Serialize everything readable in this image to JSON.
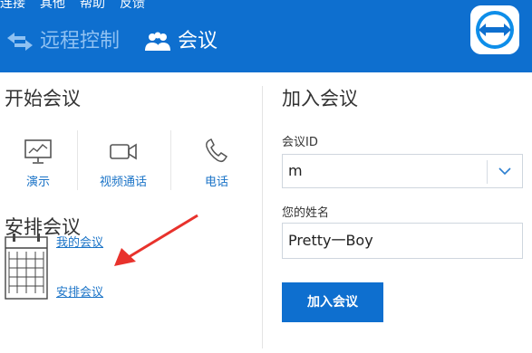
{
  "menu": [
    "连接",
    "其他",
    "帮助",
    "反馈"
  ],
  "modes": {
    "remote_control": "远程控制",
    "meeting": "会议"
  },
  "start_meeting": {
    "title": "开始会议",
    "tiles": [
      "演示",
      "视频通话",
      "电话"
    ]
  },
  "schedule": {
    "title": "安排会议",
    "my_meetings": "我的会议",
    "schedule_meeting": "安排会议"
  },
  "join": {
    "title": "加入会议",
    "id_label": "会议ID",
    "id_value": "m",
    "name_label": "您的姓名",
    "name_value": "Pretty一Boy",
    "button": "加入会议"
  },
  "colors": {
    "header_bg": "#0e6fcf",
    "link": "#1a73c7",
    "annotation_arrow": "#e8322c"
  },
  "icons": [
    "swap-arrows-icon",
    "people-icon",
    "teamviewer-logo-icon",
    "presentation-icon",
    "video-camera-icon",
    "phone-icon",
    "calendar-icon",
    "chevron-down-icon",
    "annotation-arrow-icon"
  ]
}
